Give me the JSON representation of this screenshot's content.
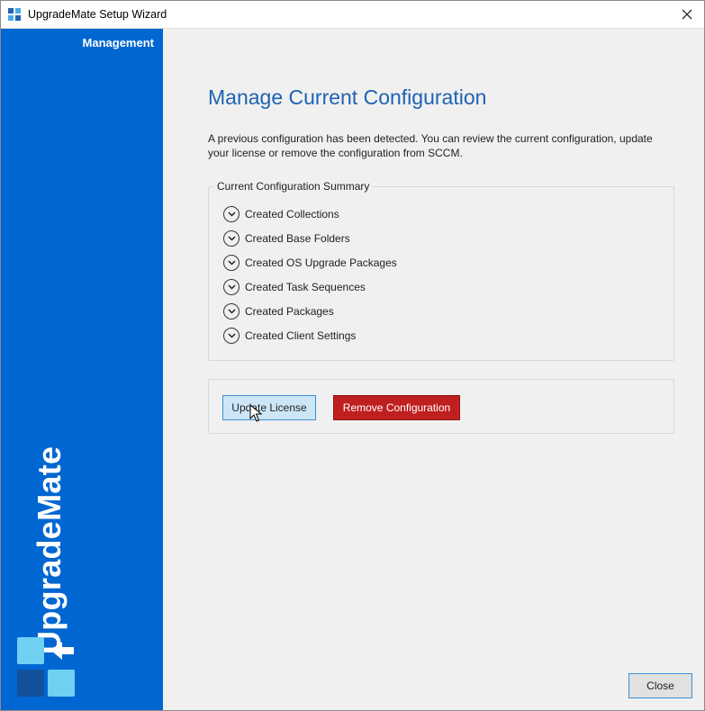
{
  "window": {
    "title": "UpgradeMate Setup Wizard"
  },
  "sidebar": {
    "section_label": "Management",
    "brand": "UpgradeMate",
    "colors": {
      "background": "#0066d1",
      "logo_light": "#6fd0f2",
      "logo_dark": "#13519a"
    }
  },
  "page": {
    "title": "Manage Current Configuration",
    "description": "A previous configuration has been detected. You can review the current configuration, update your license or remove the configuration from SCCM."
  },
  "summary": {
    "legend": "Current Configuration Summary",
    "items": [
      {
        "label": "Created Collections",
        "icon": "chevron-down-circle-icon"
      },
      {
        "label": "Created Base Folders",
        "icon": "chevron-down-circle-icon"
      },
      {
        "label": "Created OS Upgrade Packages",
        "icon": "chevron-down-circle-icon"
      },
      {
        "label": "Created Task Sequences",
        "icon": "chevron-down-circle-icon"
      },
      {
        "label": "Created Packages",
        "icon": "chevron-down-circle-icon"
      },
      {
        "label": "Created Client Settings",
        "icon": "chevron-down-circle-icon"
      }
    ]
  },
  "actions": {
    "update_label": "Update License",
    "remove_label": "Remove Configuration",
    "remove_color": "#c01f1f"
  },
  "footer": {
    "close_label": "Close"
  }
}
